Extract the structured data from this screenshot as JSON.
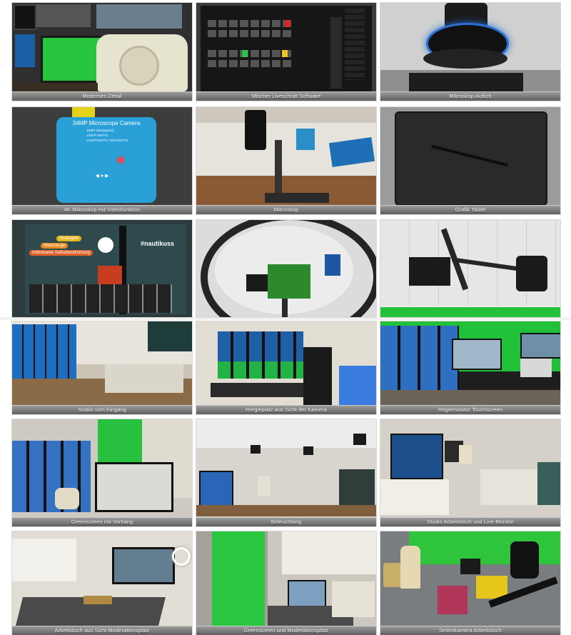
{
  "gallery": {
    "tiles": [
      {
        "caption": "Modernes Detail",
        "art": "phone"
      },
      {
        "caption": "Mischer Liveschnitt Software",
        "art": "mixer-ui"
      },
      {
        "caption": "Mikroskop Auflich",
        "art": "ring-lens"
      },
      {
        "caption": "4K Mikroskop mit Videofunktion",
        "art": "blue-camera"
      },
      {
        "caption": "Mikroskop",
        "art": "microscope"
      },
      {
        "caption": "Grafik Tablet",
        "art": "tablet"
      },
      {
        "caption": "",
        "art": "banner-wall"
      },
      {
        "caption": "",
        "art": "ringlight"
      },
      {
        "caption": "",
        "art": "ceiling-light"
      },
      {
        "caption": "Studio vom Eingang",
        "art": "studio"
      },
      {
        "caption": "Rregieplatz aus Sicht der Kamera",
        "art": "monitors"
      },
      {
        "caption": "Regiemonitor Touchscreen",
        "art": "monitors-green"
      },
      {
        "caption": "Greenscreen mit Vorhang",
        "art": "greenscreen-tv"
      },
      {
        "caption": "Beleuchtung",
        "art": "lighting"
      },
      {
        "caption": "Studio Arbeitstisch und Live-Monitor",
        "art": "workdesk"
      },
      {
        "caption": "Arbeitstisch aus Sicht Moderationsplatz",
        "art": "tv-room"
      },
      {
        "caption": "Greenscreen und Moderationsplatz",
        "art": "greenscreen-desk"
      },
      {
        "caption": "Seitenkamera Arbeitstisch",
        "art": "sidecam"
      }
    ],
    "banner": {
      "pills": [
        "Strategien",
        "Werkzeuge",
        "Individuelle Selbstbestimmung"
      ],
      "tag": "#nautikuss"
    },
    "camera_label": "34MP Microscope Camera",
    "camera_specs": [
      "34MP (Megapixel)",
      "1080P 60FPS",
      "2160P/30FPS 720P/60FPS"
    ]
  }
}
